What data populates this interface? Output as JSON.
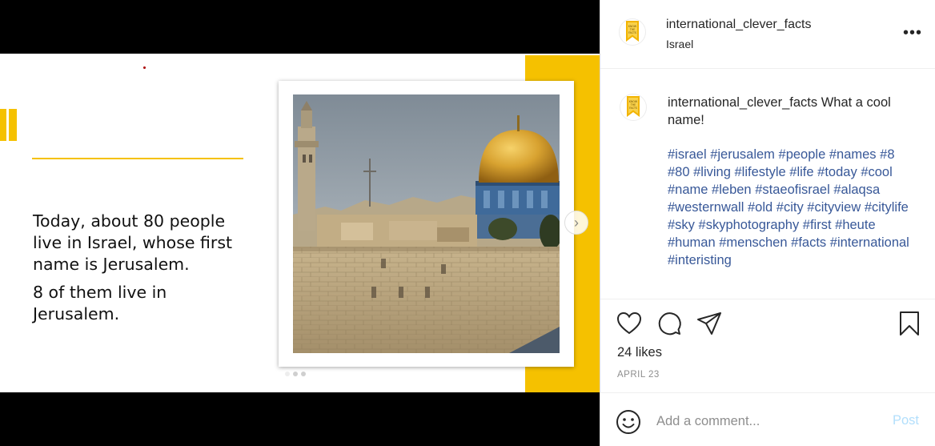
{
  "post": {
    "username": "international_clever_facts",
    "location": "Israel",
    "more_icon": "more-horizontal-icon"
  },
  "slide": {
    "paragraph1": "Today, about 80 people\nlive in Israel, whose first\nname is Jerusalem.",
    "paragraph2": " 8 of them live in\nJerusalem.",
    "accent_color": "#f5c100",
    "photo_alt": "Dome of the Rock and Western Wall, Jerusalem",
    "carousel_dots": 3,
    "active_dot": 0
  },
  "caption": {
    "username": "international_clever_facts",
    "text": " What a cool name!",
    "hashtags": [
      "#israel",
      "#jerusalem",
      "#people",
      "#names",
      "#8",
      "#80",
      "#living",
      "#lifestyle",
      "#life",
      "#today",
      "#cool",
      "#name",
      "#leben",
      "#staeofisrael",
      "#alaqsa",
      "#westernwall",
      "#old",
      "#city",
      "#cityview",
      "#citylife",
      "#sky",
      "#skyphotography",
      "#first",
      "#heute",
      "#human",
      "#menschen",
      "#facts",
      "#international",
      "#interisting"
    ]
  },
  "stats": {
    "likes": "24 likes",
    "date": "APRIL 23"
  },
  "comment": {
    "placeholder": "Add a comment...",
    "post_label": "Post"
  },
  "colors": {
    "hashtag": "#385898",
    "post_disabled": "#b2dffc",
    "brand_yellow": "#f5c100"
  }
}
